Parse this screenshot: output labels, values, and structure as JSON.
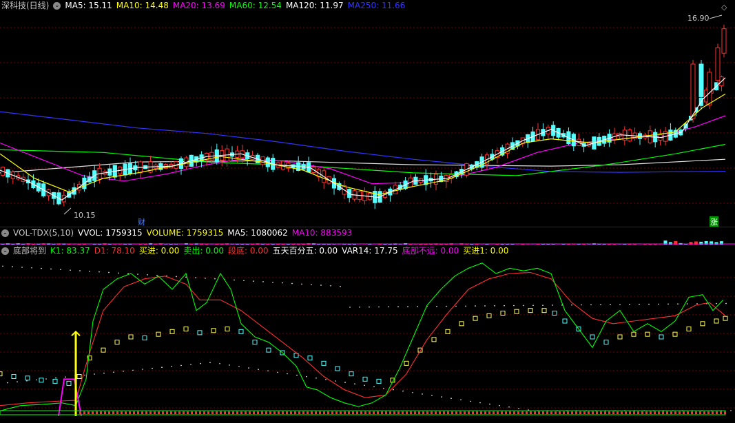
{
  "main": {
    "title": "深科技(日线)",
    "ma": [
      {
        "label": "MA5: 15.11",
        "color": "#ffffff"
      },
      {
        "label": "MA10: 14.48",
        "color": "#ffff00"
      },
      {
        "label": "MA20: 13.69",
        "color": "#ff00ff"
      },
      {
        "label": "MA60: 12.54",
        "color": "#00ff00"
      },
      {
        "label": "MA120: 11.97",
        "color": "#ffffff"
      },
      {
        "label": "MA250: 11.66",
        "color": "#3333ff"
      }
    ],
    "high_label": "16.90",
    "low_label": "10.15",
    "badge_cai": "财",
    "badge_zhang": "涨",
    "price_range": [
      9.8,
      17.5
    ],
    "ma250_points": [
      [
        0,
        13.85
      ],
      [
        100,
        13.55
      ],
      [
        200,
        13.25
      ],
      [
        300,
        13.05
      ],
      [
        400,
        12.75
      ],
      [
        500,
        12.4
      ],
      [
        600,
        12.1
      ],
      [
        700,
        11.85
      ],
      [
        800,
        11.65
      ],
      [
        900,
        11.62
      ],
      [
        1053,
        11.66
      ]
    ],
    "ma120_points": [
      [
        0,
        11.6
      ],
      [
        200,
        12.0
      ],
      [
        400,
        12.05
      ],
      [
        600,
        11.9
      ],
      [
        800,
        11.85
      ],
      [
        900,
        11.9
      ],
      [
        1053,
        12.1
      ]
    ],
    "ma60_points": [
      [
        0,
        12.45
      ],
      [
        150,
        12.35
      ],
      [
        300,
        12.0
      ],
      [
        450,
        11.85
      ],
      [
        600,
        11.6
      ],
      [
        750,
        11.5
      ],
      [
        880,
        11.9
      ],
      [
        980,
        12.3
      ],
      [
        1053,
        12.65
      ]
    ],
    "ma20_points": [
      [
        0,
        12.7
      ],
      [
        60,
        12.1
      ],
      [
        120,
        11.5
      ],
      [
        180,
        11.3
      ],
      [
        240,
        11.55
      ],
      [
        300,
        11.9
      ],
      [
        360,
        12.15
      ],
      [
        420,
        12.0
      ],
      [
        480,
        11.75
      ],
      [
        540,
        11.2
      ],
      [
        600,
        11.25
      ],
      [
        660,
        11.45
      ],
      [
        720,
        11.8
      ],
      [
        780,
        12.35
      ],
      [
        840,
        12.7
      ],
      [
        900,
        12.85
      ],
      [
        960,
        12.95
      ],
      [
        1010,
        13.3
      ],
      [
        1053,
        13.7
      ]
    ],
    "ma10_points": [
      [
        0,
        12.3
      ],
      [
        50,
        11.4
      ],
      [
        100,
        10.9
      ],
      [
        150,
        11.4
      ],
      [
        200,
        11.6
      ],
      [
        260,
        11.9
      ],
      [
        320,
        12.2
      ],
      [
        380,
        12.0
      ],
      [
        440,
        11.7
      ],
      [
        500,
        11.1
      ],
      [
        550,
        10.8
      ],
      [
        600,
        11.1
      ],
      [
        650,
        11.35
      ],
      [
        700,
        11.9
      ],
      [
        760,
        12.7
      ],
      [
        800,
        12.85
      ],
      [
        860,
        12.7
      ],
      [
        920,
        12.9
      ],
      [
        980,
        13.1
      ],
      [
        1020,
        14.0
      ],
      [
        1053,
        14.5
      ]
    ],
    "ma5_points": [
      [
        0,
        11.7
      ],
      [
        40,
        11.3
      ],
      [
        90,
        10.6
      ],
      [
        140,
        11.55
      ],
      [
        200,
        11.8
      ],
      [
        250,
        11.85
      ],
      [
        300,
        12.2
      ],
      [
        350,
        12.3
      ],
      [
        400,
        11.9
      ],
      [
        450,
        11.8
      ],
      [
        510,
        10.8
      ],
      [
        550,
        10.7
      ],
      [
        600,
        11.3
      ],
      [
        650,
        11.4
      ],
      [
        700,
        12.0
      ],
      [
        760,
        12.8
      ],
      [
        800,
        13.2
      ],
      [
        850,
        12.6
      ],
      [
        900,
        13.0
      ],
      [
        960,
        12.9
      ],
      [
        990,
        13.1
      ],
      [
        1020,
        14.3
      ],
      [
        1053,
        15.1
      ]
    ]
  },
  "vol": {
    "indicator": "VOL-TDX(5,10)",
    "values": [
      {
        "label": "VVOL: 1759315",
        "color": "#ffffff"
      },
      {
        "label": "VOLUME: 1759315",
        "color": "#ffff00"
      },
      {
        "label": "MA5: 1080062",
        "color": "#ffffff"
      },
      {
        "label": "MA10: 883593",
        "color": "#ff00ff"
      }
    ]
  },
  "ind": {
    "indicator": "底部将到",
    "values": [
      {
        "label": "K1: 83.37",
        "color": "#00ff00"
      },
      {
        "label": "D1: 78.10",
        "color": "#ff3030"
      },
      {
        "label": "买进: 0.00",
        "color": "#ffff00"
      },
      {
        "label": "卖出: 0.00",
        "color": "#00ff00"
      },
      {
        "label": "段底: 0.00",
        "color": "#ff3030"
      },
      {
        "label": "五天百分五: 0.00",
        "color": "#ffffff"
      },
      {
        "label": "VAR14: 17.75",
        "color": "#ffffff"
      },
      {
        "label": "底部不远: 0.00",
        "color": "#ff00ff"
      },
      {
        "label": "买进1: 0.00",
        "color": "#ffff00"
      }
    ],
    "k_points": [
      [
        0,
        10
      ],
      [
        30,
        20
      ],
      [
        60,
        22
      ],
      [
        90,
        25
      ],
      [
        110,
        20
      ],
      [
        125,
        70
      ],
      [
        135,
        180
      ],
      [
        150,
        240
      ],
      [
        170,
        260
      ],
      [
        190,
        270
      ],
      [
        210,
        250
      ],
      [
        230,
        265
      ],
      [
        250,
        240
      ],
      [
        270,
        270
      ],
      [
        285,
        200
      ],
      [
        300,
        215
      ],
      [
        320,
        270
      ],
      [
        335,
        240
      ],
      [
        350,
        175
      ],
      [
        370,
        150
      ],
      [
        390,
        140
      ],
      [
        410,
        120
      ],
      [
        430,
        95
      ],
      [
        445,
        55
      ],
      [
        460,
        50
      ],
      [
        480,
        35
      ],
      [
        500,
        25
      ],
      [
        520,
        18
      ],
      [
        540,
        25
      ],
      [
        560,
        40
      ],
      [
        580,
        90
      ],
      [
        600,
        150
      ],
      [
        620,
        210
      ],
      [
        640,
        240
      ],
      [
        660,
        265
      ],
      [
        680,
        280
      ],
      [
        700,
        290
      ],
      [
        720,
        270
      ],
      [
        740,
        280
      ],
      [
        760,
        275
      ],
      [
        780,
        280
      ],
      [
        800,
        270
      ],
      [
        820,
        200
      ],
      [
        840,
        165
      ],
      [
        860,
        130
      ],
      [
        880,
        180
      ],
      [
        900,
        200
      ],
      [
        920,
        160
      ],
      [
        940,
        175
      ],
      [
        960,
        160
      ],
      [
        980,
        180
      ],
      [
        1000,
        225
      ],
      [
        1020,
        230
      ],
      [
        1035,
        200
      ],
      [
        1050,
        220
      ]
    ],
    "d_points": [
      [
        0,
        20
      ],
      [
        40,
        25
      ],
      [
        80,
        28
      ],
      [
        110,
        30
      ],
      [
        130,
        120
      ],
      [
        150,
        200
      ],
      [
        180,
        245
      ],
      [
        210,
        260
      ],
      [
        240,
        265
      ],
      [
        270,
        250
      ],
      [
        290,
        220
      ],
      [
        320,
        220
      ],
      [
        350,
        200
      ],
      [
        380,
        170
      ],
      [
        410,
        140
      ],
      [
        440,
        110
      ],
      [
        470,
        75
      ],
      [
        500,
        50
      ],
      [
        530,
        35
      ],
      [
        560,
        40
      ],
      [
        590,
        80
      ],
      [
        620,
        145
      ],
      [
        650,
        195
      ],
      [
        680,
        240
      ],
      [
        710,
        260
      ],
      [
        740,
        270
      ],
      [
        770,
        272
      ],
      [
        800,
        260
      ],
      [
        830,
        215
      ],
      [
        860,
        185
      ],
      [
        890,
        175
      ],
      [
        920,
        180
      ],
      [
        950,
        185
      ],
      [
        980,
        190
      ],
      [
        1010,
        210
      ],
      [
        1030,
        215
      ],
      [
        1053,
        190
      ]
    ],
    "sq_points": [
      [
        0,
        80
      ],
      [
        20,
        75
      ],
      [
        40,
        72
      ],
      [
        60,
        68
      ],
      [
        80,
        66
      ],
      [
        100,
        62
      ],
      [
        115,
        75
      ],
      [
        130,
        110
      ],
      [
        150,
        125
      ],
      [
        170,
        140
      ],
      [
        190,
        150
      ],
      [
        210,
        148
      ],
      [
        230,
        155
      ],
      [
        250,
        160
      ],
      [
        270,
        165
      ],
      [
        290,
        158
      ],
      [
        310,
        162
      ],
      [
        330,
        165
      ],
      [
        350,
        160
      ],
      [
        370,
        140
      ],
      [
        390,
        125
      ],
      [
        410,
        120
      ],
      [
        430,
        115
      ],
      [
        450,
        110
      ],
      [
        470,
        100
      ],
      [
        490,
        90
      ],
      [
        510,
        80
      ],
      [
        530,
        70
      ],
      [
        550,
        66
      ],
      [
        570,
        68
      ],
      [
        590,
        100
      ],
      [
        610,
        125
      ],
      [
        630,
        145
      ],
      [
        650,
        160
      ],
      [
        670,
        175
      ],
      [
        690,
        185
      ],
      [
        710,
        190
      ],
      [
        730,
        195
      ],
      [
        750,
        198
      ],
      [
        770,
        200
      ],
      [
        790,
        200
      ],
      [
        805,
        195
      ],
      [
        820,
        180
      ],
      [
        840,
        165
      ],
      [
        860,
        150
      ],
      [
        880,
        140
      ],
      [
        900,
        150
      ],
      [
        920,
        155
      ],
      [
        940,
        155
      ],
      [
        960,
        150
      ],
      [
        980,
        155
      ],
      [
        1000,
        165
      ],
      [
        1020,
        175
      ],
      [
        1040,
        180
      ],
      [
        1053,
        185
      ]
    ],
    "y_range": [
      0,
      300
    ]
  }
}
